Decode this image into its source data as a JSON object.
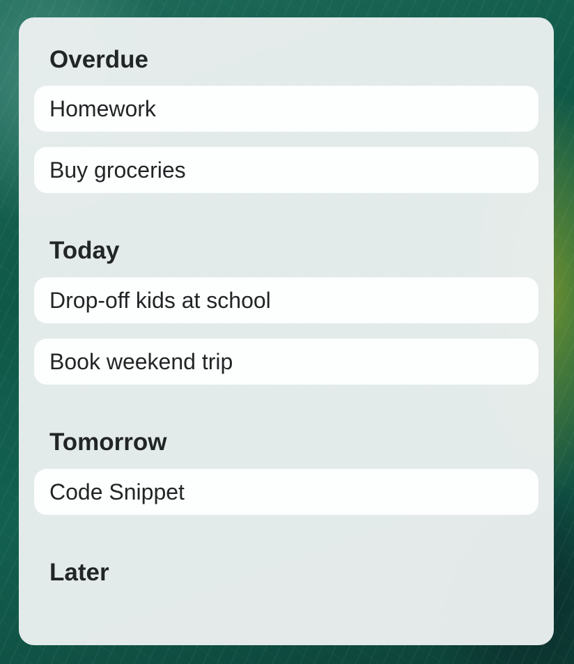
{
  "widget": {
    "sections": [
      {
        "header": "Overdue",
        "tasks": [
          "Homework",
          "Buy groceries"
        ]
      },
      {
        "header": "Today",
        "tasks": [
          "Drop-off kids at school",
          "Book weekend trip"
        ]
      },
      {
        "header": "Tomorrow",
        "tasks": [
          "Code Snippet"
        ]
      },
      {
        "header": "Later",
        "tasks": []
      }
    ]
  },
  "colors": {
    "card_background": "#ECF0F0",
    "task_background": "#FDFEFE",
    "text": "#222526",
    "wallpaper": "#0F5848"
  }
}
